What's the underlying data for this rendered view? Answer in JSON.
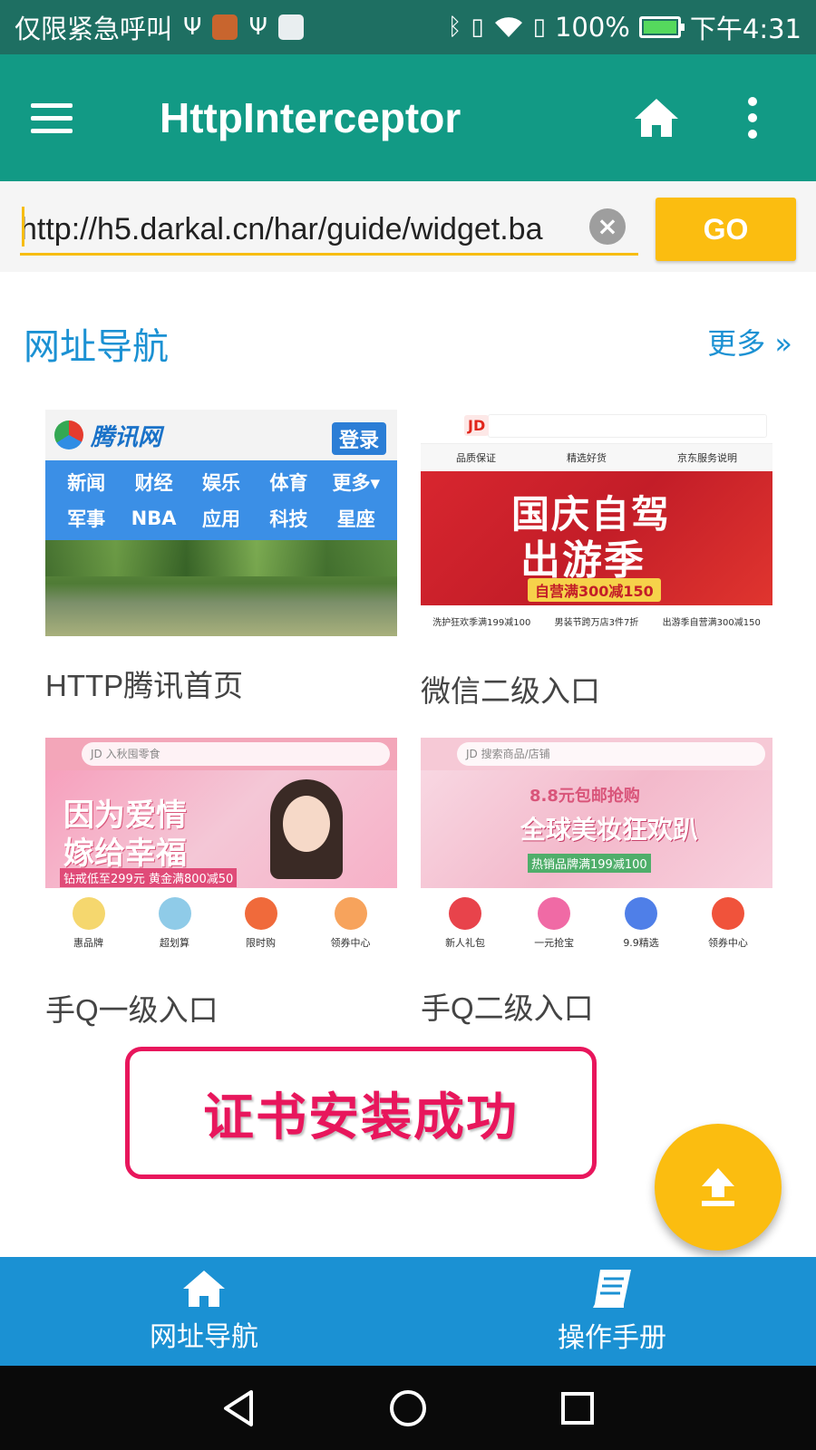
{
  "status_bar": {
    "carrier": "仅限紧急呼叫",
    "battery": "100%",
    "time": "下午4:31"
  },
  "toolbar": {
    "title": "HttpInterceptor"
  },
  "url_bar": {
    "value": "http://h5.darkal.cn/har/guide/widget.ba",
    "go_label": "GO"
  },
  "section": {
    "title": "网址导航",
    "more": "更多 »"
  },
  "cards": [
    {
      "label": "HTTP腾讯首页",
      "thumb": {
        "logo": "腾讯网",
        "login": "登录",
        "nav": [
          "新闻",
          "财经",
          "娱乐",
          "体育",
          "更多▾",
          "军事",
          "NBA",
          "应用",
          "科技",
          "星座"
        ]
      }
    },
    {
      "label": "微信二级入口",
      "thumb": {
        "logo": "JD",
        "strip": [
          "品质保证",
          "精选好货",
          "京东服务说明"
        ],
        "line1": "国庆自驾",
        "line2": "出游季",
        "tag": "自营满300减150",
        "bottom": [
          "洗护狂欢季满199减100",
          "男装节跨万店3件7折",
          "出游季自营满300减150"
        ]
      }
    },
    {
      "label": "手Q一级入口",
      "thumb": {
        "search": "JD  入秋囤零食",
        "line1": "因为爱情",
        "line2": "嫁给幸福",
        "strip": "钻戒低至299元  黄金满800减50",
        "icons": [
          "惠品牌",
          "超划算",
          "限时购",
          "领券中心"
        ],
        "icon_colors": [
          "#f5d76e",
          "#8fcbe8",
          "#f06a3b",
          "#f7a35c"
        ]
      }
    },
    {
      "label": "手Q二级入口",
      "thumb": {
        "search": "JD  搜索商品/店铺",
        "line1": "8.8元包邮抢购",
        "line2": "全球美妆狂欢趴",
        "strip": "热销品牌满199减100",
        "icons": [
          "新人礼包",
          "一元抢宝",
          "9.9精选",
          "领券中心"
        ],
        "icon_colors": [
          "#e8434b",
          "#f06aa5",
          "#4f7fe8",
          "#f0533b"
        ]
      }
    }
  ],
  "toast": {
    "message": "证书安装成功"
  },
  "bottom_nav": {
    "items": [
      {
        "label": "网址导航",
        "icon": "home-icon"
      },
      {
        "label": "操作手册",
        "icon": "book-icon"
      }
    ]
  },
  "colors": {
    "primary": "#129a85",
    "primary_dark": "#1e6f62",
    "accent": "#fbbd10",
    "link": "#1b91d3",
    "toast": "#e8165c"
  }
}
